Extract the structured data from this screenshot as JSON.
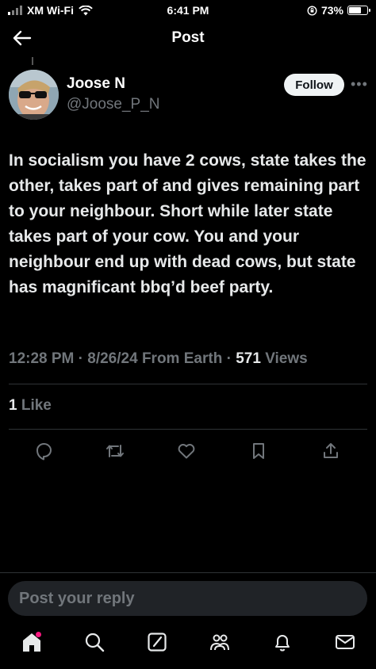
{
  "status_bar": {
    "carrier": "XM Wi-Fi",
    "time": "6:41 PM",
    "battery_pct": "73%",
    "battery_level": 0.73
  },
  "header": {
    "title": "Post"
  },
  "author": {
    "name": "Joose N",
    "handle": "@Joose_P_N",
    "follow_label": "Follow"
  },
  "tweet": {
    "text": "In socialism you have 2 cows, state takes the other, takes part of and gives remaining part to your neighbour. Short while later state takes part of your cow. You and your neighbour end up with dead cows, but state has magnificant bbq’d beef party.",
    "time": "12:28 PM",
    "date": "8/26/24",
    "source": "From Earth",
    "views_count": "571",
    "views_label": "Views",
    "likes_count": "1",
    "likes_label": "Like"
  },
  "actions": [
    "reply-icon",
    "repost-icon",
    "like-icon",
    "bookmark-icon",
    "share-icon"
  ],
  "reply": {
    "placeholder": "Post your reply"
  },
  "bottom_nav": [
    "home-icon",
    "search-icon",
    "grok-icon",
    "communities-icon",
    "notifications-icon",
    "messages-icon"
  ],
  "colors": {
    "accent_notification": "#f91880",
    "muted": "#71767b",
    "text": "#e7e9ea",
    "background": "#000000"
  }
}
